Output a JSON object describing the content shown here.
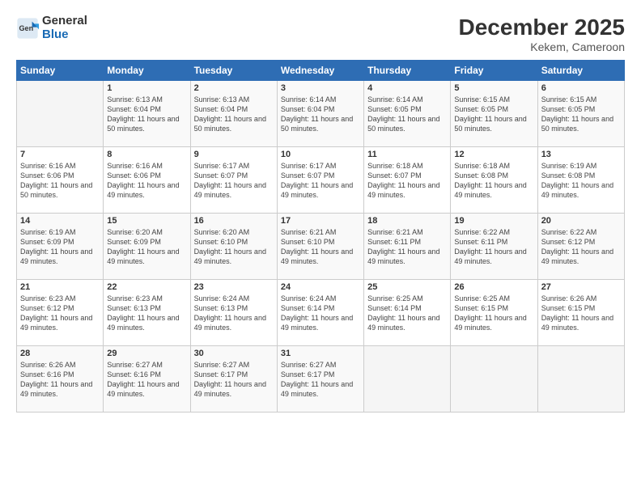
{
  "logo": {
    "general": "General",
    "blue": "Blue"
  },
  "title": {
    "month_year": "December 2025",
    "location": "Kekem, Cameroon"
  },
  "header": {
    "days": [
      "Sunday",
      "Monday",
      "Tuesday",
      "Wednesday",
      "Thursday",
      "Friday",
      "Saturday"
    ]
  },
  "weeks": [
    [
      {
        "day": "",
        "info": ""
      },
      {
        "day": "1",
        "info": "Sunrise: 6:13 AM\nSunset: 6:04 PM\nDaylight: 11 hours and 50 minutes."
      },
      {
        "day": "2",
        "info": "Sunrise: 6:13 AM\nSunset: 6:04 PM\nDaylight: 11 hours and 50 minutes."
      },
      {
        "day": "3",
        "info": "Sunrise: 6:14 AM\nSunset: 6:04 PM\nDaylight: 11 hours and 50 minutes."
      },
      {
        "day": "4",
        "info": "Sunrise: 6:14 AM\nSunset: 6:05 PM\nDaylight: 11 hours and 50 minutes."
      },
      {
        "day": "5",
        "info": "Sunrise: 6:15 AM\nSunset: 6:05 PM\nDaylight: 11 hours and 50 minutes."
      },
      {
        "day": "6",
        "info": "Sunrise: 6:15 AM\nSunset: 6:05 PM\nDaylight: 11 hours and 50 minutes."
      }
    ],
    [
      {
        "day": "7",
        "info": "Sunrise: 6:16 AM\nSunset: 6:06 PM\nDaylight: 11 hours and 50 minutes."
      },
      {
        "day": "8",
        "info": "Sunrise: 6:16 AM\nSunset: 6:06 PM\nDaylight: 11 hours and 49 minutes."
      },
      {
        "day": "9",
        "info": "Sunrise: 6:17 AM\nSunset: 6:07 PM\nDaylight: 11 hours and 49 minutes."
      },
      {
        "day": "10",
        "info": "Sunrise: 6:17 AM\nSunset: 6:07 PM\nDaylight: 11 hours and 49 minutes."
      },
      {
        "day": "11",
        "info": "Sunrise: 6:18 AM\nSunset: 6:07 PM\nDaylight: 11 hours and 49 minutes."
      },
      {
        "day": "12",
        "info": "Sunrise: 6:18 AM\nSunset: 6:08 PM\nDaylight: 11 hours and 49 minutes."
      },
      {
        "day": "13",
        "info": "Sunrise: 6:19 AM\nSunset: 6:08 PM\nDaylight: 11 hours and 49 minutes."
      }
    ],
    [
      {
        "day": "14",
        "info": "Sunrise: 6:19 AM\nSunset: 6:09 PM\nDaylight: 11 hours and 49 minutes."
      },
      {
        "day": "15",
        "info": "Sunrise: 6:20 AM\nSunset: 6:09 PM\nDaylight: 11 hours and 49 minutes."
      },
      {
        "day": "16",
        "info": "Sunrise: 6:20 AM\nSunset: 6:10 PM\nDaylight: 11 hours and 49 minutes."
      },
      {
        "day": "17",
        "info": "Sunrise: 6:21 AM\nSunset: 6:10 PM\nDaylight: 11 hours and 49 minutes."
      },
      {
        "day": "18",
        "info": "Sunrise: 6:21 AM\nSunset: 6:11 PM\nDaylight: 11 hours and 49 minutes."
      },
      {
        "day": "19",
        "info": "Sunrise: 6:22 AM\nSunset: 6:11 PM\nDaylight: 11 hours and 49 minutes."
      },
      {
        "day": "20",
        "info": "Sunrise: 6:22 AM\nSunset: 6:12 PM\nDaylight: 11 hours and 49 minutes."
      }
    ],
    [
      {
        "day": "21",
        "info": "Sunrise: 6:23 AM\nSunset: 6:12 PM\nDaylight: 11 hours and 49 minutes."
      },
      {
        "day": "22",
        "info": "Sunrise: 6:23 AM\nSunset: 6:13 PM\nDaylight: 11 hours and 49 minutes."
      },
      {
        "day": "23",
        "info": "Sunrise: 6:24 AM\nSunset: 6:13 PM\nDaylight: 11 hours and 49 minutes."
      },
      {
        "day": "24",
        "info": "Sunrise: 6:24 AM\nSunset: 6:14 PM\nDaylight: 11 hours and 49 minutes."
      },
      {
        "day": "25",
        "info": "Sunrise: 6:25 AM\nSunset: 6:14 PM\nDaylight: 11 hours and 49 minutes."
      },
      {
        "day": "26",
        "info": "Sunrise: 6:25 AM\nSunset: 6:15 PM\nDaylight: 11 hours and 49 minutes."
      },
      {
        "day": "27",
        "info": "Sunrise: 6:26 AM\nSunset: 6:15 PM\nDaylight: 11 hours and 49 minutes."
      }
    ],
    [
      {
        "day": "28",
        "info": "Sunrise: 6:26 AM\nSunset: 6:16 PM\nDaylight: 11 hours and 49 minutes."
      },
      {
        "day": "29",
        "info": "Sunrise: 6:27 AM\nSunset: 6:16 PM\nDaylight: 11 hours and 49 minutes."
      },
      {
        "day": "30",
        "info": "Sunrise: 6:27 AM\nSunset: 6:17 PM\nDaylight: 11 hours and 49 minutes."
      },
      {
        "day": "31",
        "info": "Sunrise: 6:27 AM\nSunset: 6:17 PM\nDaylight: 11 hours and 49 minutes."
      },
      {
        "day": "",
        "info": ""
      },
      {
        "day": "",
        "info": ""
      },
      {
        "day": "",
        "info": ""
      }
    ]
  ]
}
